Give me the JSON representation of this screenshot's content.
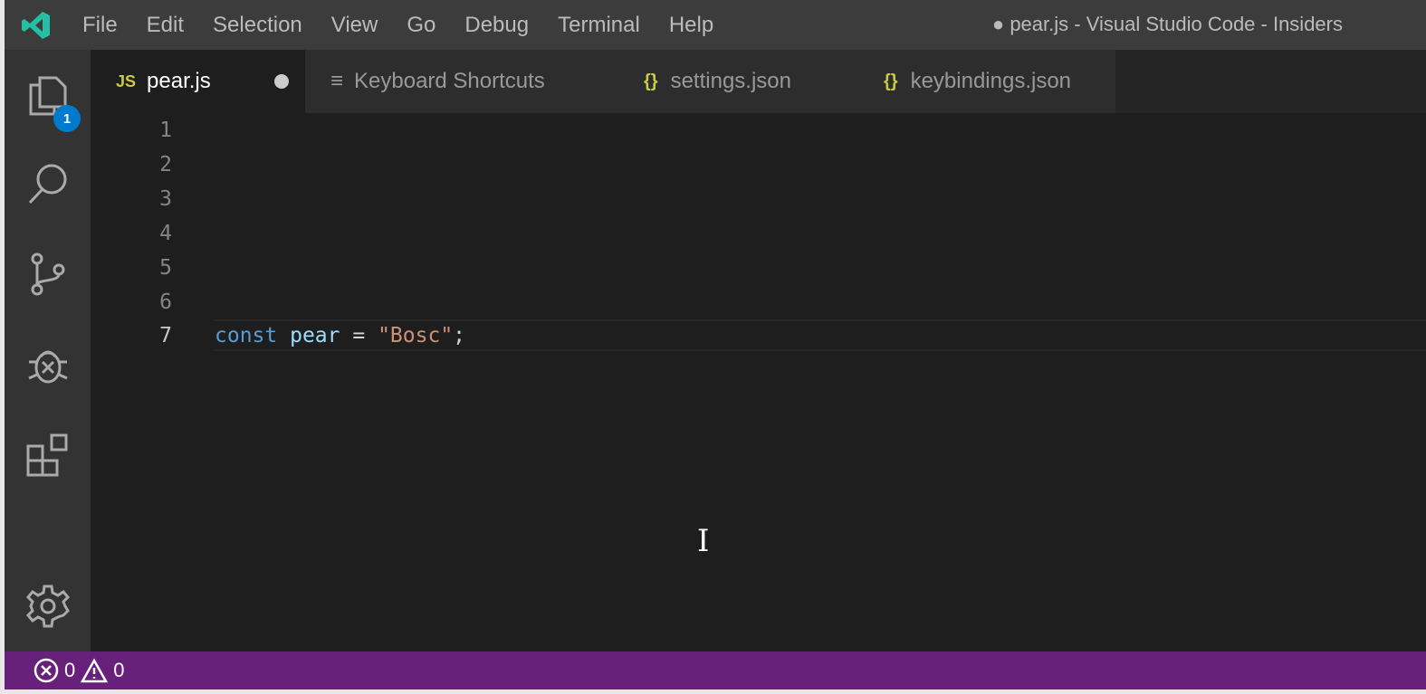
{
  "title_bar": {
    "menu": [
      "File",
      "Edit",
      "Selection",
      "View",
      "Go",
      "Debug",
      "Terminal",
      "Help"
    ],
    "window_title": "● pear.js - Visual Studio Code - Insiders"
  },
  "activity_bar": {
    "explorer_badge": "1"
  },
  "tabs": [
    {
      "label": "pear.js",
      "icon": "JS"
    },
    {
      "label": "Keyboard Shortcuts",
      "icon": "≡"
    },
    {
      "label": "settings.json",
      "icon": "{}"
    },
    {
      "label": "keybindings.json",
      "icon": "{}"
    }
  ],
  "editor": {
    "line_numbers": [
      "1",
      "2",
      "3",
      "4",
      "5",
      "6",
      "7"
    ],
    "code": {
      "keyword": "const",
      "name": "pear",
      "op": "=",
      "string": "\"Bosc\"",
      "semi": ";"
    }
  },
  "status_bar": {
    "errors": "0",
    "warnings": "0"
  },
  "colors": {
    "status": "#68217a",
    "accent": "#007acc"
  }
}
